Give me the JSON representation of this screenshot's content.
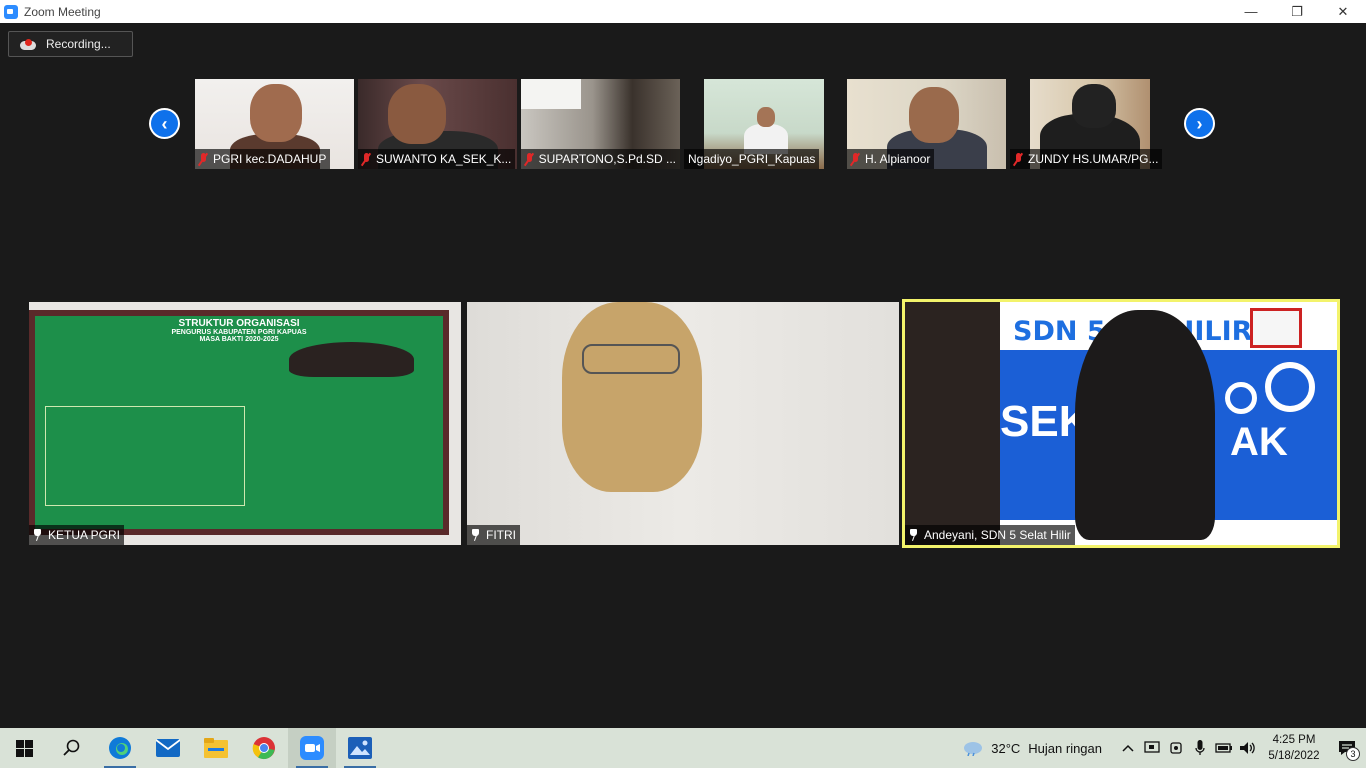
{
  "window": {
    "title": "Zoom Meeting",
    "minimize_glyph": "—",
    "restore_glyph": "❐",
    "close_glyph": "✕"
  },
  "recording": {
    "label": "Recording..."
  },
  "nav": {
    "prev_glyph": "‹",
    "next_glyph": "›"
  },
  "thumbnails": [
    {
      "name": "PGRI kec.DADAHUP",
      "muted": true
    },
    {
      "name": "SUWANTO KA_SEK_K...",
      "muted": true
    },
    {
      "name": "SUPARTONO,S.Pd.SD ...",
      "muted": true
    },
    {
      "name": "Ngadiyo_PGRI_Kapuas",
      "muted": false
    },
    {
      "name": "H. Alpianoor",
      "muted": true
    },
    {
      "name": "ZUNDY HS.UMAR/PG...",
      "muted": true
    }
  ],
  "tiles": [
    {
      "name": "KETUA PGRI",
      "pinned": true,
      "banner": {
        "title": "STRUKTUR ORGANISASI",
        "subtitle": "PENGURUS KABUPATEN PGRI KAPUAS",
        "period": "MASA BAKTI 2020-2025"
      }
    },
    {
      "name": "FITRI",
      "pinned": true
    },
    {
      "name": "Andeyani, SDN 5 Selat Hilir",
      "pinned": true,
      "active": true,
      "backdrop": {
        "top_text": "SDN 5 SE  HILIR",
        "mid_text": "SEK",
        "right_text": "AK"
      }
    }
  ],
  "taskbar": {
    "apps": [
      "windows-start",
      "search",
      "edge",
      "mail",
      "file-explorer",
      "chrome",
      "zoom",
      "photos"
    ],
    "weather": {
      "temp": "32°C",
      "condition": "Hujan ringan"
    },
    "time": "4:25 PM",
    "date": "5/18/2022",
    "notification_count": "3"
  },
  "colors": {
    "accent_blue": "#0e71eb",
    "active_speaker": "#f3f36b",
    "muted_red": "#e02828",
    "stage_bg": "#1a1a1a",
    "taskbar_bg": "#d9e2d7"
  }
}
